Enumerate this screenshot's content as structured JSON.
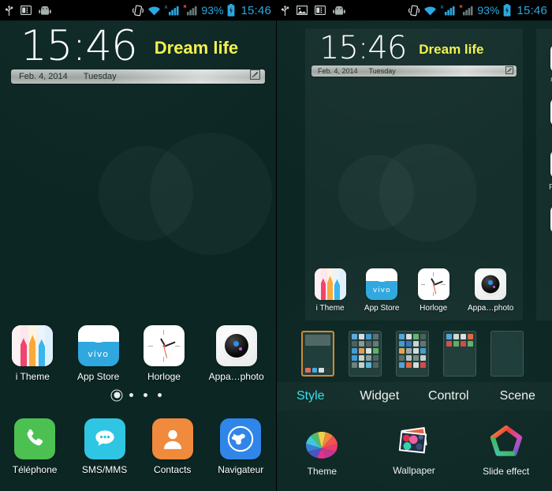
{
  "status_bar": {
    "left_icons_left_panel": [
      "usb-icon",
      "sim-card-icon",
      "android-robot-icon"
    ],
    "left_icons_right_panel": [
      "usb-icon",
      "image-screenshot-icon",
      "sim-card-icon",
      "android-robot-icon"
    ],
    "right_icons": [
      "vibrate-icon",
      "wifi-icon",
      "signal-roaming-icon",
      "signal-no-service-icon",
      "battery-charging-icon"
    ],
    "battery": "93%",
    "time": "15:46",
    "accent_color": "#2aa9e2"
  },
  "clock_widget": {
    "time": "15:46",
    "tagline": "Dream life",
    "date": "Feb. 4, 2014",
    "weekday": "Tuesday",
    "edit_icon": "edit-pencil-icon",
    "tagline_color": "#f2f24e"
  },
  "wallpaper": {
    "background_color": "#0b2623",
    "circle_color": "rgba(230,255,250,0.035)"
  },
  "home_apps": [
    {
      "label": "i Theme",
      "icon": "i-theme-icon"
    },
    {
      "label": "App Store",
      "icon": "vivo-app-store-icon"
    },
    {
      "label": "Horloge",
      "icon": "clock-icon"
    },
    {
      "label": "Appa…photo",
      "icon": "camera-icon"
    }
  ],
  "page_indicator": {
    "total": 4,
    "current": 1
  },
  "dock_apps": [
    {
      "label": "Téléphone",
      "icon": "phone-icon",
      "color": "#4cc152"
    },
    {
      "label": "SMS/MMS",
      "icon": "message-icon",
      "color": "#2fc6e3"
    },
    {
      "label": "Contacts",
      "icon": "contacts-icon",
      "color": "#f08a3c"
    },
    {
      "label": "Navigateur",
      "icon": "browser-globe-icon",
      "color": "#2f86e8"
    }
  ],
  "editor": {
    "next_screen_partial_label": "FX",
    "screen_thumbnails": [
      {
        "name": "screen-1",
        "selected": true,
        "type": "widget-and-dock"
      },
      {
        "name": "screen-2",
        "selected": false,
        "type": "full-grid"
      },
      {
        "name": "screen-3",
        "selected": false,
        "type": "full-grid"
      },
      {
        "name": "screen-4",
        "selected": false,
        "type": "one-row"
      },
      {
        "name": "screen-5",
        "selected": false,
        "type": "empty"
      }
    ],
    "tabs": [
      {
        "label": "Style",
        "active": true
      },
      {
        "label": "Widget",
        "active": false
      },
      {
        "label": "Control",
        "active": false
      },
      {
        "label": "Scene",
        "active": false
      }
    ],
    "active_tab_color": "#37e0e8",
    "tools": [
      {
        "label": "Theme",
        "icon": "color-fan-icon"
      },
      {
        "label": "Wallpaper",
        "icon": "photo-stack-icon"
      },
      {
        "label": "Slide effect",
        "icon": "pentagon-star-icon"
      }
    ],
    "selected_thumb_border_color": "#d08a2e"
  }
}
